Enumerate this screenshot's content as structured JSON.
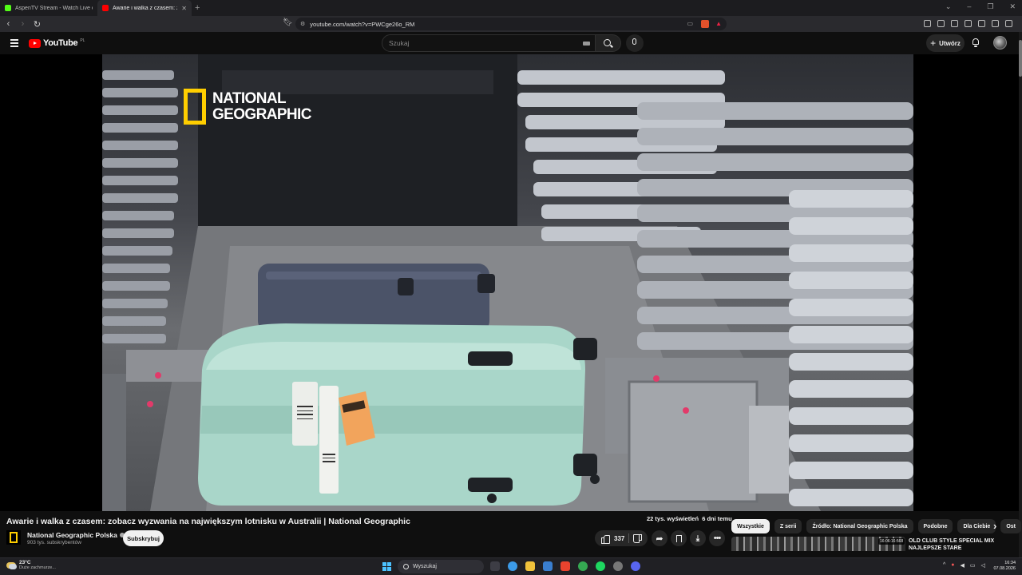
{
  "browser": {
    "tabs": [
      {
        "title": "AspenTV Stream - Watch Live on Kick",
        "favicon_color": "#53fc18",
        "active": false
      },
      {
        "title": "Awarie i walka z czasem: zobacz",
        "favicon_color": "#ff0000",
        "active": true
      }
    ],
    "url": "youtube.com/watch?v=PWCge26o_RM"
  },
  "header": {
    "logo_text": "YouTube",
    "region": "PL",
    "search_placeholder": "Szukaj",
    "create_label": "Utwórz",
    "create_plus": "+"
  },
  "video": {
    "watermark_line1": "NATIONAL",
    "watermark_line2": "GEOGRAPHIC",
    "title": "Awarie i walka z czasem: zobacz wyzwania na największym lotnisku w Australii | National Geographic",
    "views": "22 tys. wyświetleń",
    "age": "6 dni temu"
  },
  "channel": {
    "name": "National Geographic Polska",
    "subscribers": "903 tys. subskrybentów",
    "subscribe_label": "Subskrybuj"
  },
  "actions": {
    "likes": "337"
  },
  "chips": [
    "Wszystkie",
    "Z serii",
    "Źródło: National Geographic Polska",
    "Podobne",
    "Dla Ciebie",
    "Ost"
  ],
  "recommendation": {
    "duration": "16:06:16:568",
    "title": "OLD CLUB STYLE SPECIAL MIX NAJLEPSZE STARE"
  },
  "taskbar": {
    "temperature": "23°C",
    "weather": "Duże zachmurze...",
    "search_label": "Wyszukaj",
    "time": "16:34",
    "date": "07.08.2026",
    "app_colors": [
      "#3d3d45",
      "#3c9be8",
      "#f0c23b",
      "#3a7fd0",
      "#e8432e",
      "#35a852",
      "#1ed760",
      "#777777",
      "#5865f2"
    ]
  },
  "colors": {
    "accent": "#ff0000",
    "natgeo_yellow": "#ffce00",
    "background": "#0f0f0f"
  }
}
